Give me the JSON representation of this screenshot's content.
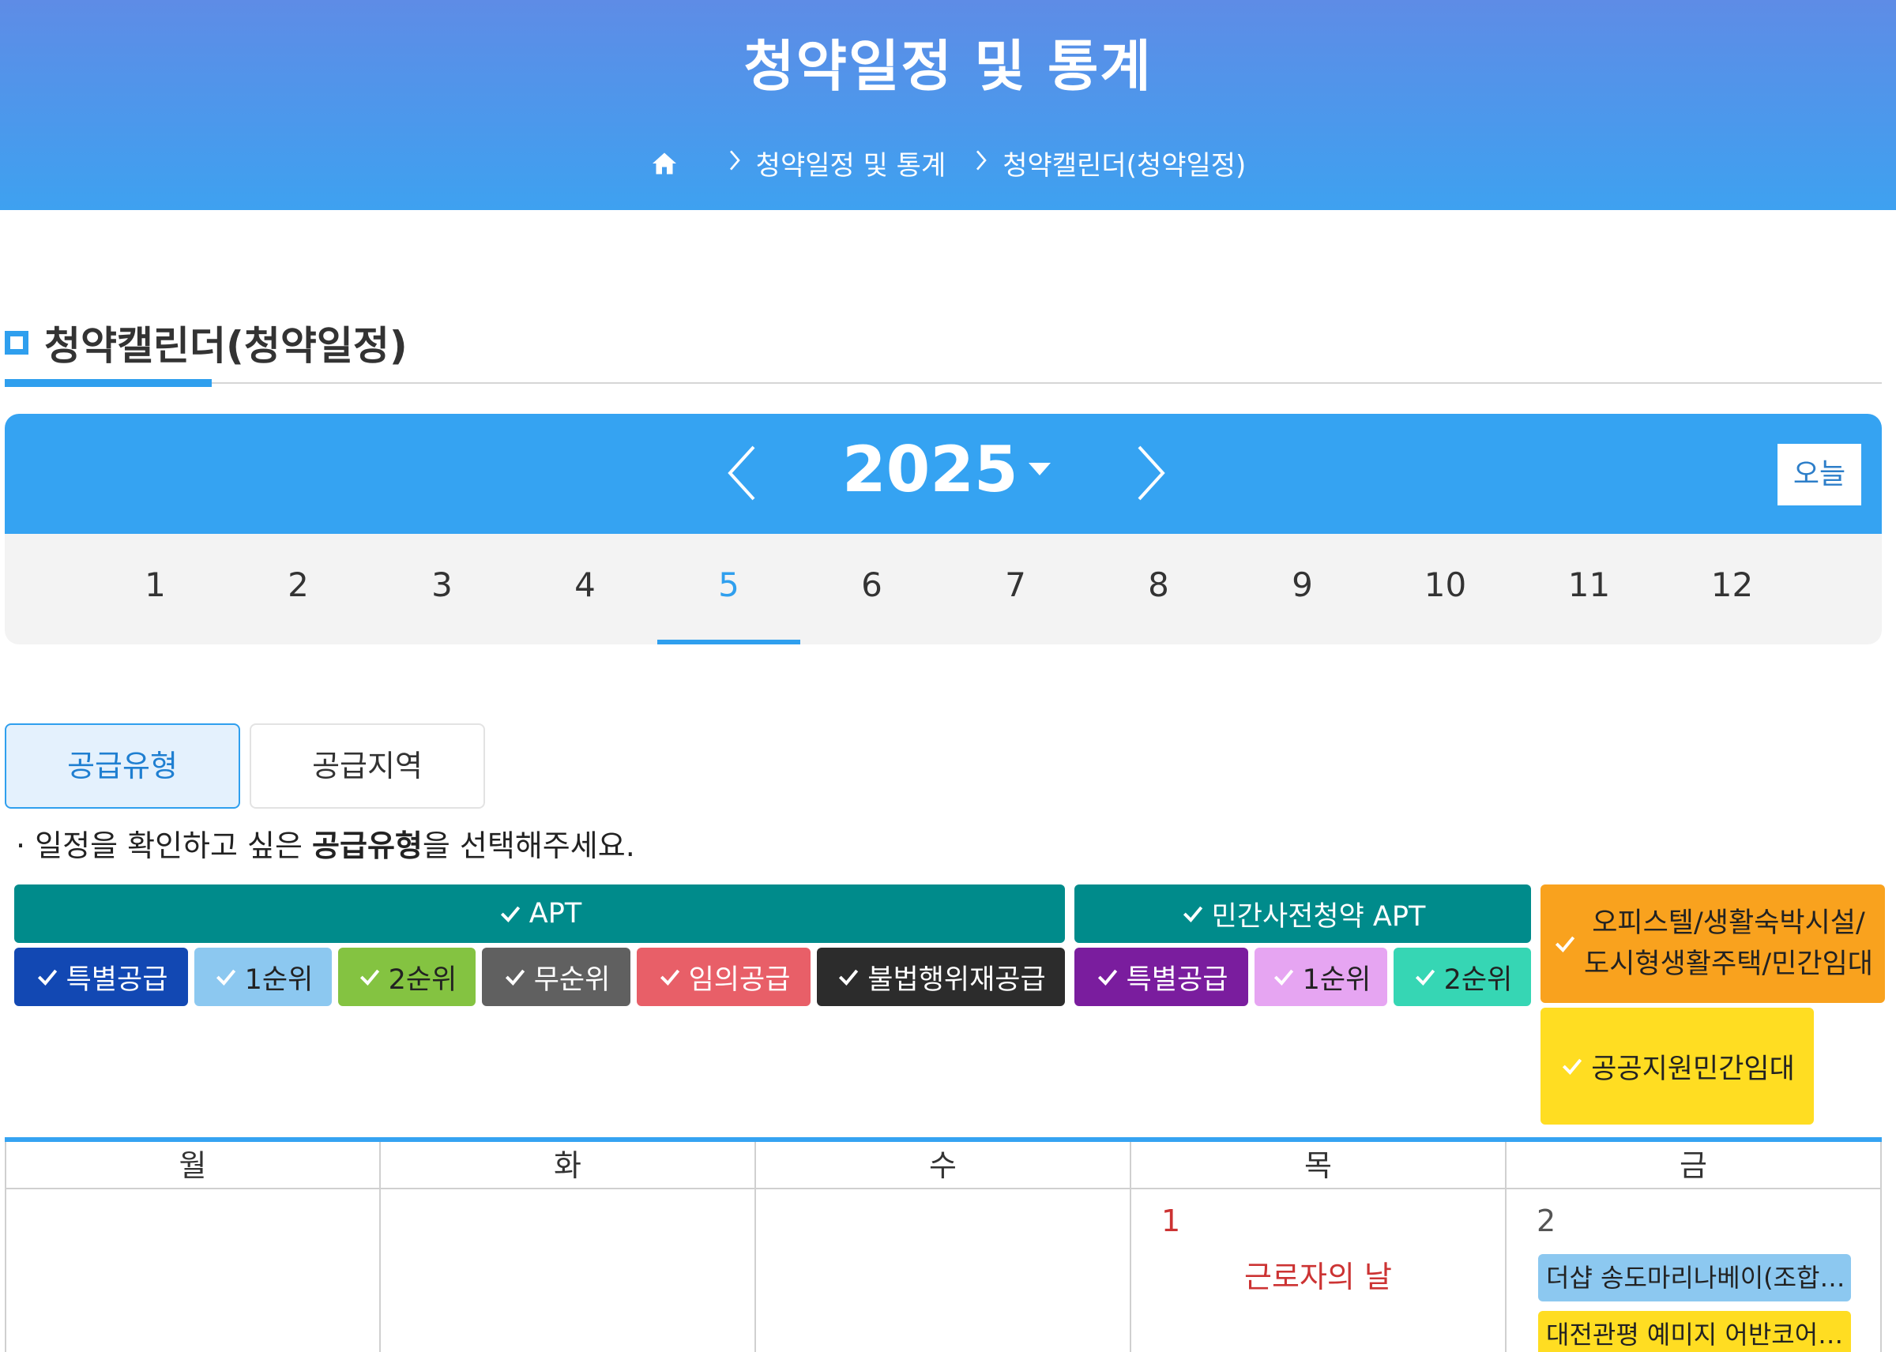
{
  "header": {
    "title": "청약일정 및 통계",
    "breadcrumb": [
      "청약일정 및 통계",
      "청약캘린더(청약일정)"
    ]
  },
  "section": {
    "title": "청약캘린더(청약일정)"
  },
  "year_bar": {
    "year": "2025",
    "today_label": "오늘"
  },
  "months": [
    "1",
    "2",
    "3",
    "4",
    "5",
    "6",
    "7",
    "8",
    "9",
    "10",
    "11",
    "12"
  ],
  "selected_month": "5",
  "tabs": [
    {
      "label": "공급유형",
      "active": true
    },
    {
      "label": "공급지역",
      "active": false
    }
  ],
  "hint": {
    "prefix": "· 일정을 확인하고 싶은 ",
    "bold": "공급유형",
    "suffix": "을 선택해주세요."
  },
  "filters": {
    "apt_group": {
      "label": "APT",
      "color": "#008b8b",
      "items": [
        {
          "label": "특별공급",
          "color": "#1248b3"
        },
        {
          "label": "1순위",
          "color": "#8cc8f0"
        },
        {
          "label": "2순위",
          "color": "#84c341"
        },
        {
          "label": "무순위",
          "color": "#606060"
        },
        {
          "label": "임의공급",
          "color": "#e85f68"
        },
        {
          "label": "불법행위재공급",
          "color": "#2c2c2c"
        }
      ]
    },
    "pre_group": {
      "label": "민간사전청약 APT",
      "color": "#008b8b",
      "items": [
        {
          "label": "특별공급",
          "color": "#7a1d9e"
        },
        {
          "label": "1순위",
          "color": "#e6a5f2"
        },
        {
          "label": "2순위",
          "color": "#36d6b4"
        }
      ]
    },
    "officetel": {
      "label_line1": "오피스텔/생활숙박시설/",
      "label_line2": "도시형생활주택/민간임대",
      "color": "#f9a21e"
    },
    "public_rental": {
      "label": "공공지원민간임대",
      "color": "#ffdd22"
    }
  },
  "calendar": {
    "weekdays": [
      "월",
      "화",
      "수",
      "목",
      "금"
    ],
    "days": [
      {
        "col": 3,
        "day": "1",
        "holiday": "근로자의 날"
      },
      {
        "col": 4,
        "day": "2",
        "events": [
          {
            "label": "더샵 송도마리나베이(조합…",
            "color": "#8cc8f0"
          },
          {
            "label": "대전관평 예미지 어반코어…",
            "color": "#ffdd22"
          }
        ]
      }
    ]
  }
}
